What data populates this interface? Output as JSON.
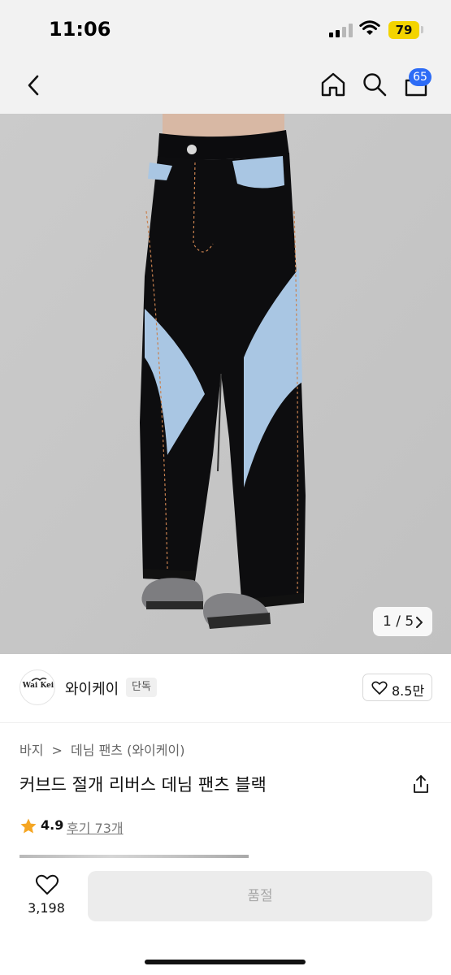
{
  "status_bar": {
    "time": "11:06",
    "battery": "79"
  },
  "header": {
    "cart_count": "65"
  },
  "gallery": {
    "pager": "1 / 5"
  },
  "brand": {
    "name": "와이케이",
    "tag": "단독",
    "logo_text": "Wai Kei",
    "like_count": "8.5만"
  },
  "breadcrumb": {
    "items": [
      "바지",
      "데님 팬츠 (와이케이)"
    ],
    "separator": ">"
  },
  "product": {
    "title": "커브드 절개 리버스 데님 팬츠 블랙",
    "rating": "4.9",
    "reviews": "후기 73개"
  },
  "bottom": {
    "wish_count": "3,198",
    "soldout_label": "품절"
  },
  "colors": {
    "accent": "#2d6cf6",
    "star": "#f5a623",
    "battery": "#f3d400",
    "denim_black": "#0d0d0f",
    "denim_blue": "#a9c6e3"
  }
}
